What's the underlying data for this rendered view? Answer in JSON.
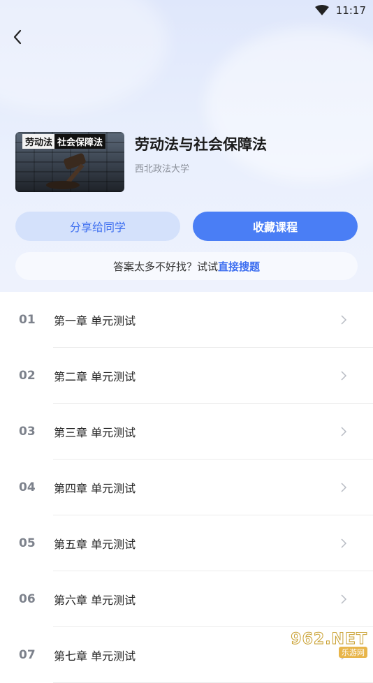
{
  "status": {
    "time": "11:17"
  },
  "course": {
    "cover_text_left": "劳动法",
    "cover_text_right": "社会保障法",
    "title": "劳动法与社会保障法",
    "school": "西北政法大学"
  },
  "actions": {
    "share_label": "分享给同学",
    "favorite_label": "收藏课程"
  },
  "hint": {
    "text": "答案太多不好找？试试",
    "link": "直接搜题"
  },
  "chapters": [
    {
      "num": "01",
      "title": "第一章 单元测试"
    },
    {
      "num": "02",
      "title": "第二章 单元测试"
    },
    {
      "num": "03",
      "title": "第三章 单元测试"
    },
    {
      "num": "04",
      "title": "第四章 单元测试"
    },
    {
      "num": "05",
      "title": "第五章 单元测试"
    },
    {
      "num": "06",
      "title": "第六章 单元测试"
    },
    {
      "num": "07",
      "title": "第七章 单元测试"
    }
  ],
  "watermark": {
    "top": "962.NET",
    "bottom": "乐游网"
  },
  "colors": {
    "accent": "#4a7ef5",
    "accent_light": "#d4e1fb",
    "link": "#3e6ff0"
  }
}
